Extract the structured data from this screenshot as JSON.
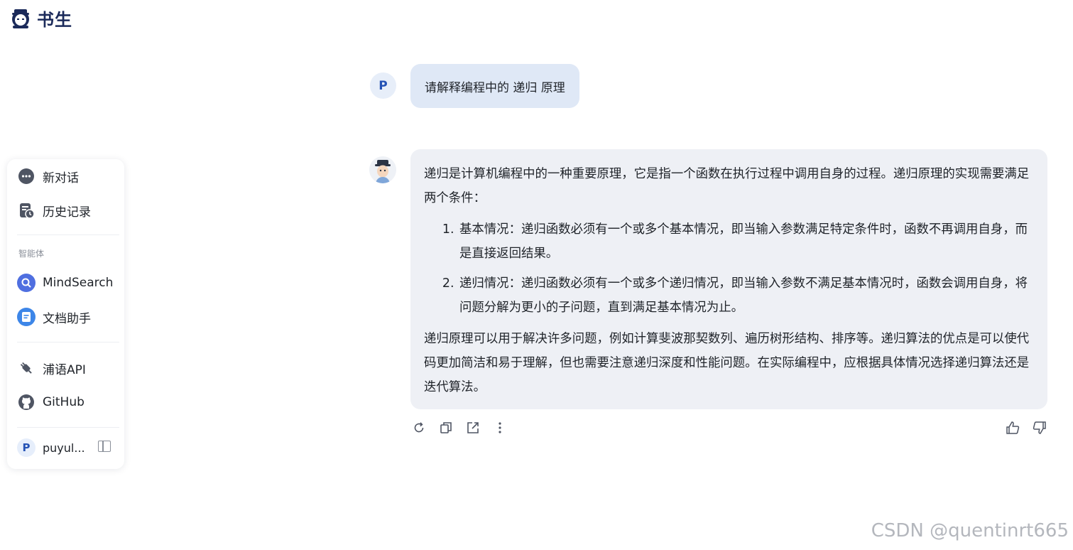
{
  "brand": {
    "name": "书生"
  },
  "sidebar": {
    "new_chat": "新对话",
    "history": "历史记录",
    "agents_section": "智能体",
    "agents": [
      {
        "label": "MindSearch",
        "icon": "mindsearch-icon"
      },
      {
        "label": "文档助手",
        "icon": "document-assistant-icon"
      }
    ],
    "api_label": "浦语API",
    "github_label": "GitHub",
    "user": {
      "initial": "P",
      "name": "puyul..."
    }
  },
  "chat": {
    "user_initial": "P",
    "user_message": "请解释编程中的 递归 原理",
    "assistant": {
      "intro": "递归是计算机编程中的一种重要原理，它是指一个函数在执行过程中调用自身的过程。递归原理的实现需要满足两个条件：",
      "conditions": [
        "基本情况：递归函数必须有一个或多个基本情况，即当输入参数满足特定条件时，函数不再调用自身，而是直接返回结果。",
        "递归情况：递归函数必须有一个或多个递归情况，即当输入参数不满足基本情况时，函数会调用自身，将问题分解为更小的子问题，直到满足基本情况为止。"
      ],
      "conclusion": "递归原理可以用于解决许多问题，例如计算斐波那契数列、遍历树形结构、排序等。递归算法的优点是可以使代码更加简洁和易于理解，但也需要注意递归深度和性能问题。在实际编程中，应根据具体情况选择递归算法还是迭代算法。"
    },
    "actions": [
      "regenerate-icon",
      "copy-icon",
      "share-icon",
      "more-icon",
      "thumbs-up-icon",
      "thumbs-down-icon"
    ]
  },
  "watermark": "CSDN @quentinrt665",
  "colors": {
    "accent": "#2452b5",
    "user_bubble": "#dfe8f6",
    "bot_bubble": "#eef0f5"
  }
}
